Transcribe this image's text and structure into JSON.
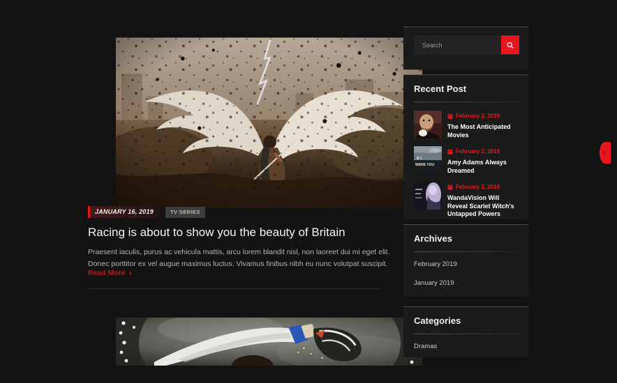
{
  "theme": {
    "accent": "#e8171f",
    "background": "#131313",
    "panel_background": "#1b1b1b",
    "read_more_color": "#a81e24"
  },
  "icons": {
    "search": "magnifier",
    "calendar": "calendar",
    "read_more_arrow": "›",
    "customizer": "⚙"
  },
  "main": {
    "article": {
      "date": "JANUARY 16, 2019",
      "tag": "TV SERIES",
      "title": "Racing is about to show you the beauty of Britain",
      "excerpt": "Praesent iaculis, purus ac vehicula mattis, arcu lorem blandit nisl, non laoreet dui mi eget elit. Donec porttitor ex vel augue maximus luctus. Vivamus finibus nibh eu nunc volutpat suscipit.",
      "read_more": "Read More"
    }
  },
  "sidebar": {
    "search": {
      "placeholder": "Search"
    },
    "recent": {
      "title": "Recent Post",
      "posts": [
        {
          "date": "February 2, 2019",
          "title": "The Most Anticipated Movies"
        },
        {
          "date": "February 2, 2019",
          "title": "Amy Adams Always Dreamed",
          "thumb_text_line1": "IF I",
          "thumb_text_line2": "WERE YOU"
        },
        {
          "date": "February 2, 2019",
          "title": "WandaVision Will Reveal Scarlet Witch's Untapped Powers"
        }
      ]
    },
    "archives": {
      "title": "Archives",
      "items": [
        "February 2019",
        "January 2019"
      ]
    },
    "categories": {
      "title": "Categories",
      "items": [
        "Dramas"
      ]
    }
  }
}
